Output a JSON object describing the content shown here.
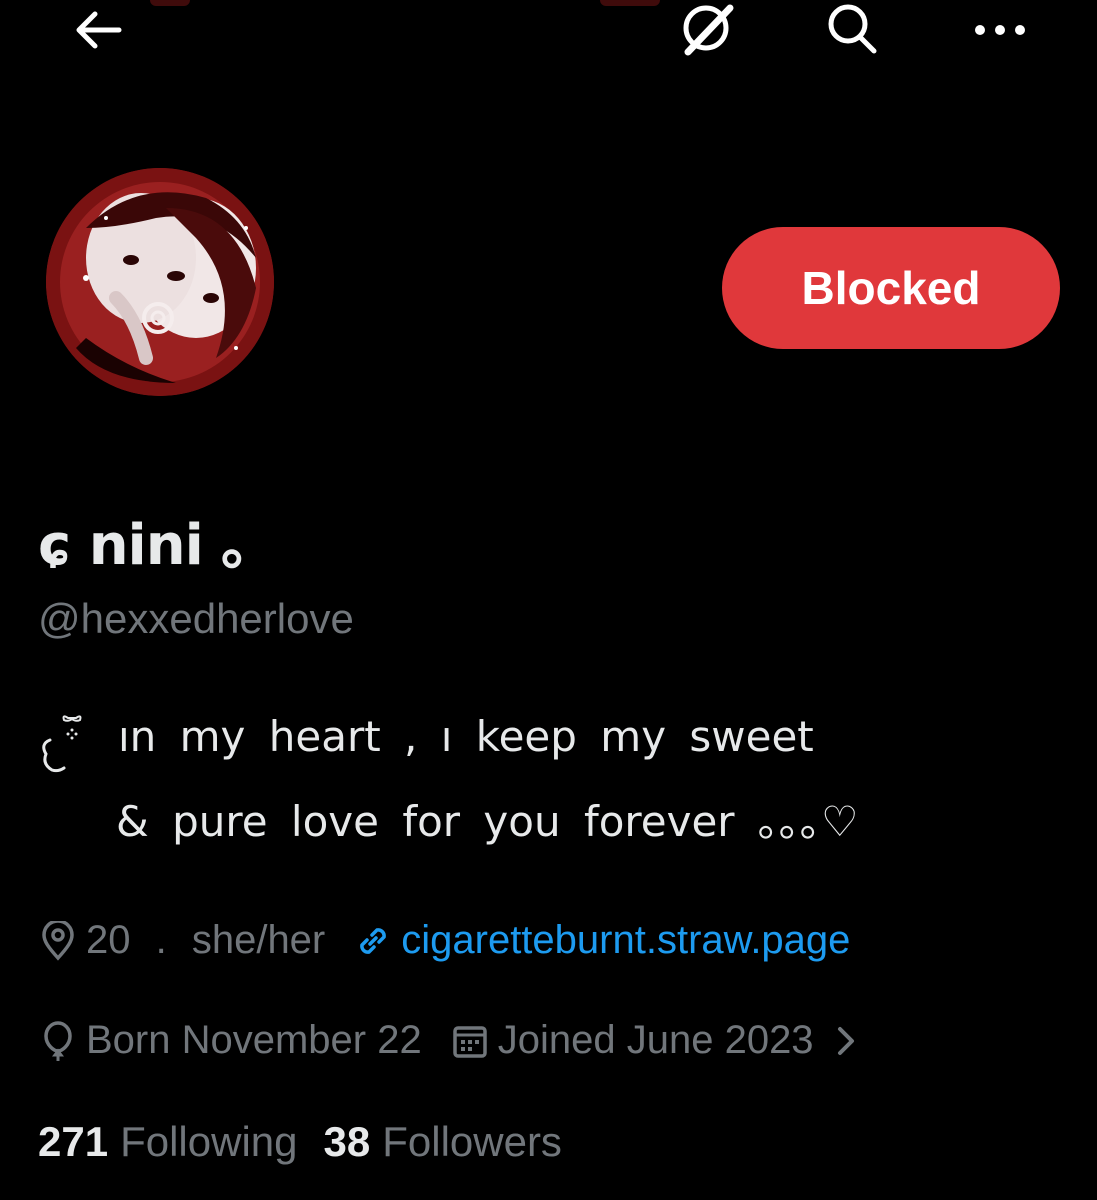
{
  "header": {
    "back_icon": "arrow-left-icon",
    "grok_icon": "grok-icon",
    "search_icon": "search-icon",
    "more_icon": "more-horizontal-icon"
  },
  "profile": {
    "display_name": "ɕ nini ｡",
    "handle": "@hexxedherlove",
    "blocked_label": "Blocked",
    "bio_line1": "ın my heart , ı keep my sweet",
    "bio_line2": "& pure love for you forever ｡｡｡♡",
    "age_pronouns": "20 . she/her",
    "link": "cigaretteburnt.straw.page",
    "birthday": "Born November 22",
    "joined": "Joined June 2023",
    "following_count": "271",
    "following_label": "Following",
    "followers_count": "38",
    "followers_label": "Followers"
  },
  "colors": {
    "background": "#000000",
    "primary_text": "#e7e9ea",
    "secondary_text": "#71767b",
    "link": "#1d9bf0",
    "blocked_button": "#e0383b"
  }
}
